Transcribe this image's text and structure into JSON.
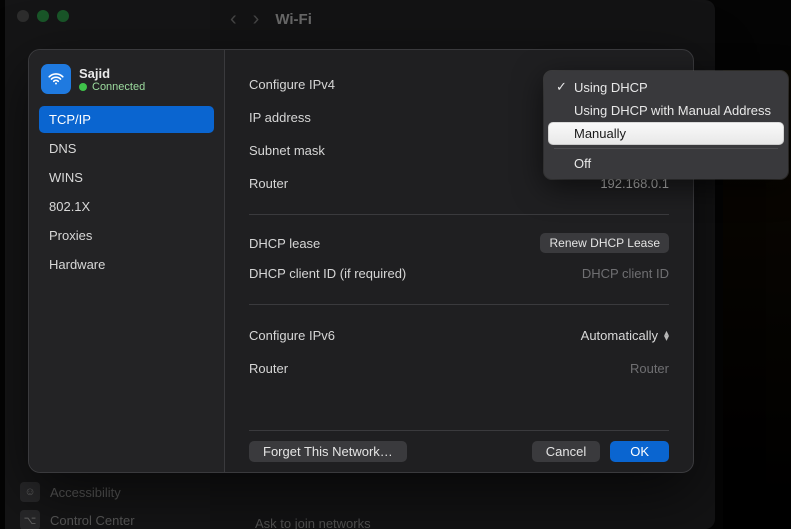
{
  "background": {
    "title": "Wi-Fi",
    "nav_back": "‹",
    "nav_fwd": "›",
    "sidebar_items": [
      {
        "label": "Accessibility"
      },
      {
        "label": "Control Center"
      }
    ],
    "content_labels": [
      "Ask to join networks"
    ]
  },
  "sheet": {
    "network_name": "Sajid",
    "network_status": "Connected",
    "sidebar": [
      {
        "label": "TCP/IP",
        "selected": true
      },
      {
        "label": "DNS"
      },
      {
        "label": "WINS"
      },
      {
        "label": "802.1X"
      },
      {
        "label": "Proxies"
      },
      {
        "label": "Hardware"
      }
    ],
    "fields": {
      "configure_ipv4_label": "Configure IPv4",
      "ip_address_label": "IP address",
      "subnet_mask_label": "Subnet mask",
      "router_label": "Router",
      "router_value": "192.168.0.1",
      "dhcp_lease_label": "DHCP lease",
      "renew_button": "Renew DHCP Lease",
      "dhcp_client_id_label": "DHCP client ID (if required)",
      "dhcp_client_id_placeholder": "DHCP client ID",
      "configure_ipv6_label": "Configure IPv6",
      "configure_ipv6_value": "Automatically",
      "router6_label": "Router",
      "router6_value": "Router"
    },
    "footer": {
      "forget": "Forget This Network…",
      "cancel": "Cancel",
      "ok": "OK"
    }
  },
  "dropdown": {
    "items": [
      {
        "label": "Using DHCP",
        "checked": true
      },
      {
        "label": "Using DHCP with Manual Address"
      },
      {
        "label": "Manually",
        "selected": true
      }
    ],
    "footer_items": [
      {
        "label": "Off"
      }
    ]
  }
}
